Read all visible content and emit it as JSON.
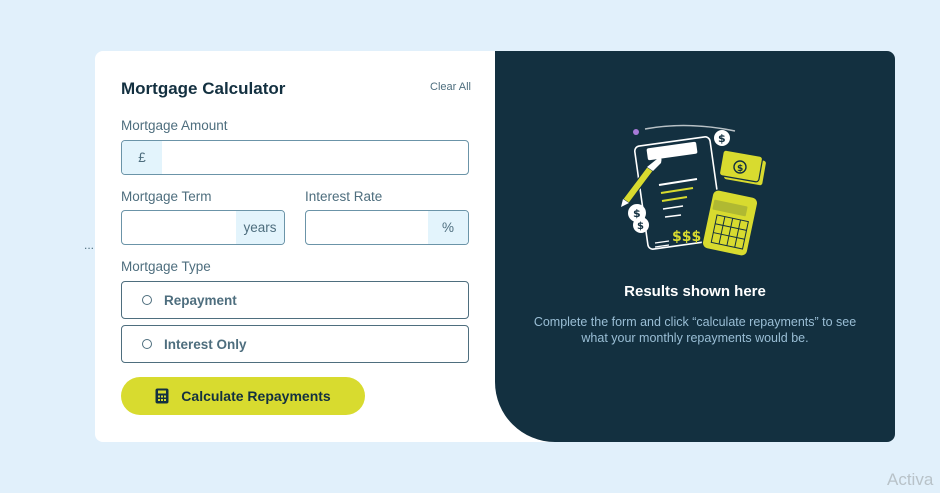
{
  "page": {
    "ellipsis": "...",
    "watermark": "Activa"
  },
  "form": {
    "title": "Mortgage Calculator",
    "clear_label": "Clear All",
    "amount": {
      "label": "Mortgage Amount",
      "prefix": "£",
      "value": ""
    },
    "term": {
      "label": "Mortgage Term",
      "suffix": "years",
      "value": ""
    },
    "rate": {
      "label": "Interest Rate",
      "suffix": "%",
      "value": ""
    },
    "type": {
      "label": "Mortgage Type",
      "options": [
        {
          "label": "Repayment",
          "selected": false
        },
        {
          "label": "Interest Only",
          "selected": false
        }
      ]
    },
    "submit_label": "Calculate Repayments",
    "submit_icon": "calculator-icon"
  },
  "results": {
    "illustration": "empty-results-illustration",
    "title": "Results shown here",
    "description": "Complete the form and click “calculate repayments” to see what your monthly repayments would be."
  },
  "colors": {
    "background": "#e1f0fb",
    "dark_panel": "#133040",
    "accent_lime": "#d8db2f",
    "muted_text": "#4e6e7e",
    "addon_bg": "#e3f4fc"
  }
}
